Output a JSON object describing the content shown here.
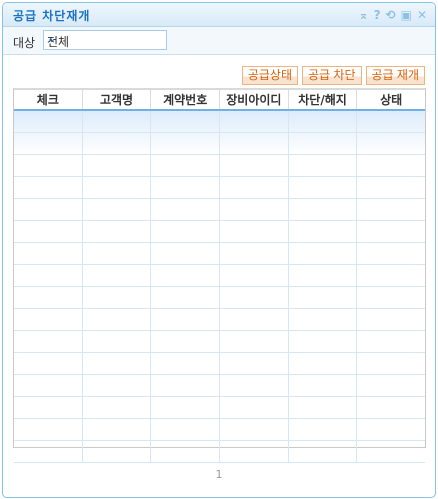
{
  "window": {
    "title": "공급 차단재개",
    "tools": [
      {
        "icon": "collapse-icon",
        "glyph": "⌅"
      },
      {
        "icon": "help-icon",
        "glyph": "?"
      },
      {
        "icon": "refresh-icon",
        "glyph": "⟲"
      },
      {
        "icon": "maximize-icon",
        "glyph": "▣"
      },
      {
        "icon": "close-icon",
        "glyph": "✕"
      }
    ]
  },
  "filter": {
    "label": "대상",
    "value": "전체"
  },
  "buttons": {
    "status": "공급상태",
    "block": "공급 차단",
    "resume": "공급 재개"
  },
  "table": {
    "columns": [
      "체크",
      "고객명",
      "계약번호",
      "장비아이디",
      "차단/해지",
      "상태"
    ],
    "rows": []
  },
  "pager": {
    "current": "1"
  }
}
